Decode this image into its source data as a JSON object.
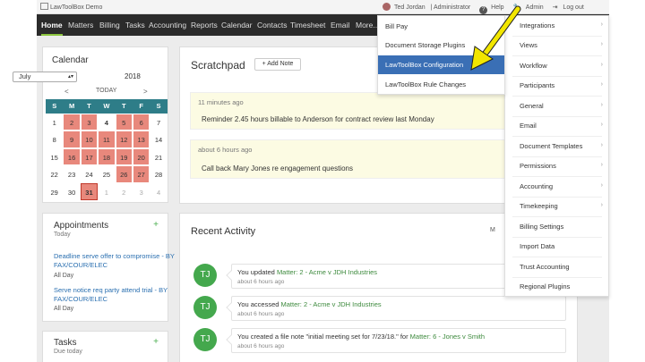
{
  "topbar": {
    "logo": "LawToolBox Demo",
    "user": "Ted Jordan",
    "role": "Administrator",
    "help": "Help",
    "admin": "Admin",
    "logout": "Log out"
  },
  "nav": [
    "Home",
    "Matters",
    "Billing",
    "Tasks",
    "Accounting",
    "Reports",
    "Calendar",
    "Contacts",
    "Timesheet",
    "Email",
    "More..."
  ],
  "calendar": {
    "title": "Calendar",
    "month": "July",
    "year": "2018",
    "today_label": "TODAY",
    "prev": "<",
    "next": ">",
    "days": [
      "S",
      "M",
      "T",
      "W",
      "T",
      "F",
      "S"
    ],
    "weeks": [
      [
        "1",
        "2",
        "3",
        "4",
        "5",
        "6",
        "7"
      ],
      [
        "8",
        "9",
        "10",
        "11",
        "12",
        "13",
        "14"
      ],
      [
        "15",
        "16",
        "17",
        "18",
        "19",
        "20",
        "21"
      ],
      [
        "22",
        "23",
        "24",
        "25",
        "26",
        "27",
        "28"
      ],
      [
        "29",
        "30",
        "31",
        "1",
        "2",
        "3",
        "4"
      ]
    ]
  },
  "appointments": {
    "title": "Appointments",
    "sub": "Today",
    "plus": "+",
    "items": [
      {
        "title": "Deadline serve offer to compromise - BY FAX/COUR/ELEC",
        "when": "All Day"
      },
      {
        "title": "Serve notice req party attend trial - BY FAX/COUR/ELEC",
        "when": "All Day"
      }
    ]
  },
  "tasks": {
    "title": "Tasks",
    "sub": "Due today",
    "plus": "+"
  },
  "scratchpad": {
    "title": "Scratchpad",
    "add_note": "+ Add Note",
    "notes": [
      {
        "time": "11 minutes ago",
        "text": "Reminder 2.45 hours billable to Anderson for contract review last Monday"
      },
      {
        "time": "about 6 hours ago",
        "text": "Call back Mary Jones re engagement questions"
      }
    ]
  },
  "recent": {
    "title": "Recent Activity",
    "control": "M",
    "items": [
      {
        "initials": "TJ",
        "pre": "You updated ",
        "link": "Matter: 2 - Acme v JDH Industries",
        "time": "about 6 hours ago"
      },
      {
        "initials": "TJ",
        "pre": "You accessed ",
        "link": "Matter: 2 - Acme v JDH Industries",
        "time": "about 6 hours ago"
      },
      {
        "initials": "TJ",
        "pre": "You created a file note \"initial meeting set for 7/23/18.\" for ",
        "link": "Matter: 6 - Jones v Smith",
        "time": "about 6 hours ago"
      }
    ]
  },
  "admin_menu": [
    "Integrations",
    "Views",
    "Workflow",
    "Participants",
    "General",
    "Email",
    "Document Templates",
    "Permissions",
    "Accounting",
    "Timekeeping",
    "Billing Settings",
    "Import Data",
    "Trust Accounting",
    "Regional Plugins"
  ],
  "integrations_menu": [
    "Bill Pay",
    "Document Storage Plugins",
    "LawToolBox Configuration",
    "LawToolBox Rule Changes"
  ],
  "colors": {
    "nav_bg": "#2b2b2b",
    "calendar_head": "#2e7d88",
    "highlight_day": "#e8887c",
    "avatar": "#44a84d",
    "menu_active": "#3a6fb5",
    "arrow": "#f2e600"
  }
}
